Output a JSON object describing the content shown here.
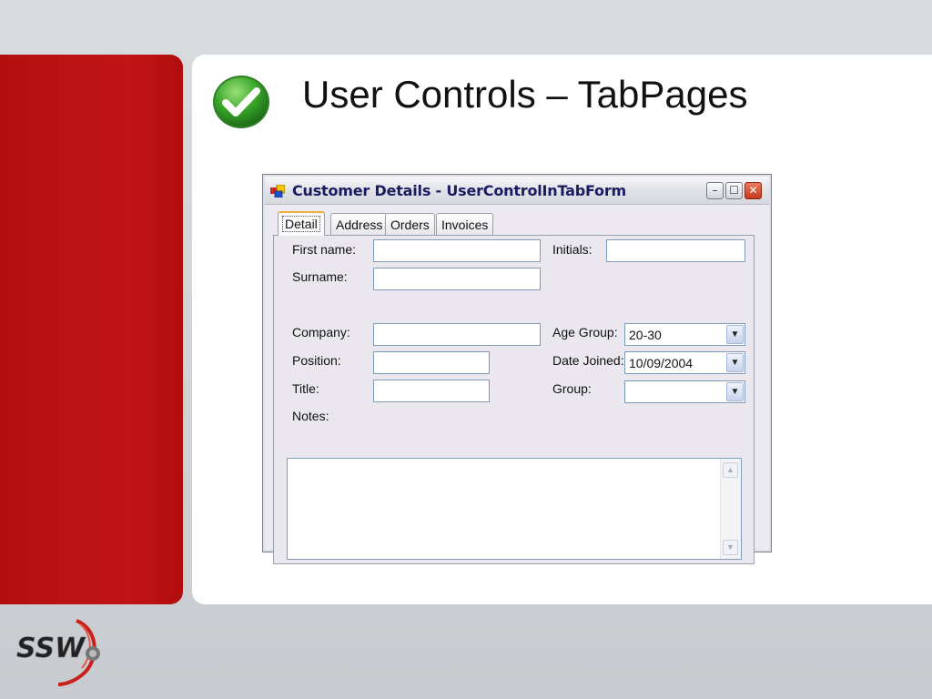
{
  "slide": {
    "title": "User Controls – TabPages"
  },
  "window": {
    "title": "Customer Details - UserControlInTabForm",
    "minimize_glyph": "–",
    "maximize_glyph": "☐",
    "close_glyph": "✕"
  },
  "tabs": [
    {
      "label": "Detail",
      "selected": true
    },
    {
      "label": "Address",
      "selected": false
    },
    {
      "label": "Orders",
      "selected": false
    },
    {
      "label": "Invoices",
      "selected": false
    }
  ],
  "form": {
    "first_name_label": "First name:",
    "first_name_value": "",
    "initials_label": "Initials:",
    "initials_value": "",
    "surname_label": "Surname:",
    "surname_value": "",
    "company_label": "Company:",
    "company_value": "",
    "age_group_label": "Age Group:",
    "age_group_value": "20-30",
    "position_label": "Position:",
    "position_value": "",
    "date_joined_label": "Date Joined:",
    "date_joined_value": "10/09/2004",
    "title_label": "Title:",
    "title_value": "",
    "group_label": "Group:",
    "group_value": "",
    "notes_label": "Notes:",
    "notes_value": ""
  },
  "icons": {
    "slide_icon": "checkmark-icon",
    "app_icon": "form-app-icon",
    "dropdown": "chevron-down-icon",
    "scroll_up": "scroll-up-arrow-icon",
    "scroll_down": "scroll-down-arrow-icon"
  },
  "colors": {
    "accent_red": "#c11414",
    "check_green": "#3aa82a",
    "title_blue": "#1b1b60",
    "active_tab_accent": "#f0b23a"
  },
  "logo": {
    "text": "SSW"
  }
}
